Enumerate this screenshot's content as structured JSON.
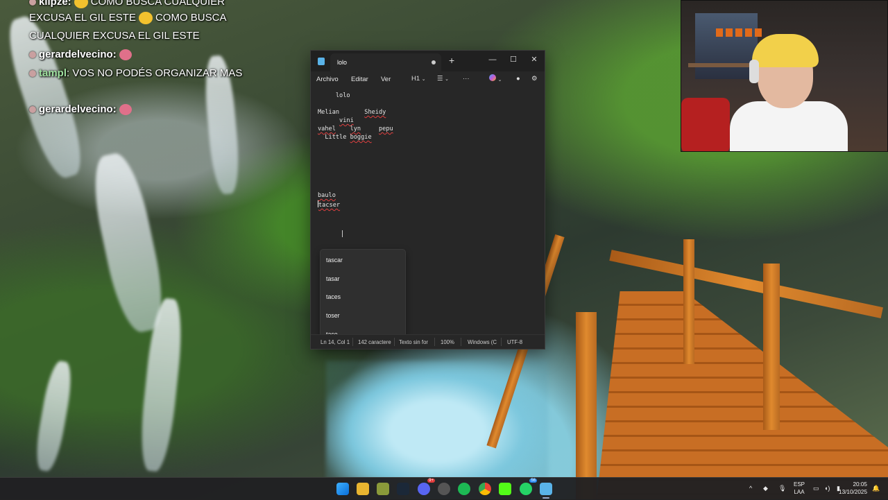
{
  "chat": {
    "lines": [
      {
        "user": "klipze:",
        "text": "COMO BUSCA CUALQUIER"
      },
      {
        "text": "EXCUSA EL GIL ESTE",
        "text2": "COMO BUSCA"
      },
      {
        "text": "CUALQUIER EXCUSA EL GIL ESTE"
      },
      {
        "user": "gerardelvecino:"
      },
      {
        "user": "tampl",
        "text": ": VOS NO PODÉS ORGANIZAR MAS"
      },
      {
        "user": "gerardelvecino:"
      }
    ]
  },
  "notepad": {
    "tab_title": "lolo",
    "new_tab": "+",
    "window_buttons": {
      "minimize": "—",
      "maximize": "☐",
      "close": "✕"
    },
    "menu": [
      "Archivo",
      "Editar",
      "Ver"
    ],
    "toolbar": {
      "heading": "H1",
      "list": "☰",
      "more": "···",
      "settings": "⚙"
    },
    "editor_lines": [
      {
        "text": "     lolo"
      },
      {
        "text": ""
      },
      {
        "parts": [
          "Melian",
          "       ",
          "Sheidy"
        ]
      },
      {
        "parts": [
          "      ",
          "vini"
        ]
      },
      {
        "parts": [
          "vahel",
          "    ",
          "lyn",
          "     ",
          "pepu"
        ]
      },
      {
        "parts": [
          "  Little ",
          "boggie"
        ]
      },
      {
        "text": "baulo"
      },
      {
        "text": "tacser"
      }
    ],
    "autocomplete": [
      "tascar",
      "tasar",
      "taces",
      "toser",
      "tace"
    ],
    "status": {
      "position": "Ln 14, Col 1",
      "chars": "142 caractere",
      "format": "Texto sin for",
      "zoom": "100%",
      "line_endings": "Windows (C",
      "encoding": "UTF-8"
    }
  },
  "taskbar": {
    "language": "ESP",
    "language_sub": "LAA",
    "time": "20:05",
    "date": "13/10/2025",
    "discord_badge": "9+",
    "whatsapp_badge": "56",
    "tray_chevron": "^"
  },
  "colors": {
    "notepad_bg": "#272727",
    "titlebar_bg": "#202020",
    "spell_underline": "#e04040",
    "taskbar_bg": "#202022"
  }
}
